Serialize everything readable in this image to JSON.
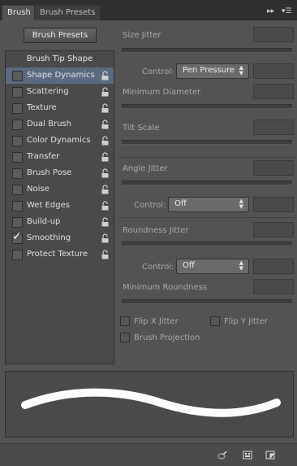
{
  "tabs": {
    "brush": "Brush",
    "brush_presets": "Brush Presets"
  },
  "presets_button": "Brush Presets",
  "brush_tip_shape": "Brush Tip Shape",
  "options": [
    {
      "label": "Shape Dynamics",
      "checked": false,
      "selected": true
    },
    {
      "label": "Scattering",
      "checked": false
    },
    {
      "label": "Texture",
      "checked": false
    },
    {
      "label": "Dual Brush",
      "checked": false
    },
    {
      "label": "Color Dynamics",
      "checked": false
    },
    {
      "label": "Transfer",
      "checked": false
    },
    {
      "label": "Brush Pose",
      "checked": false
    },
    {
      "label": "Noise",
      "checked": false
    },
    {
      "label": "Wet Edges",
      "checked": false
    },
    {
      "label": "Build-up",
      "checked": false
    },
    {
      "label": "Smoothing",
      "checked": true
    },
    {
      "label": "Protect Texture",
      "checked": false
    }
  ],
  "settings": {
    "size_jitter": "Size Jitter",
    "control_label": "Control:",
    "control1_value": "Pen Pressure",
    "minimum_diameter": "Minimum Diameter",
    "tilt_scale": "Tilt Scale",
    "angle_jitter": "Angle Jitter",
    "control2_value": "Off",
    "roundness_jitter": "Roundness Jitter",
    "control3_value": "Off",
    "minimum_roundness": "Minimum Roundness",
    "flip_x": "Flip X Jitter",
    "flip_y": "Flip Y Jitter",
    "brush_projection": "Brush Projection"
  },
  "colors": {
    "selected": "#5a6a80",
    "panel": "#535353"
  }
}
